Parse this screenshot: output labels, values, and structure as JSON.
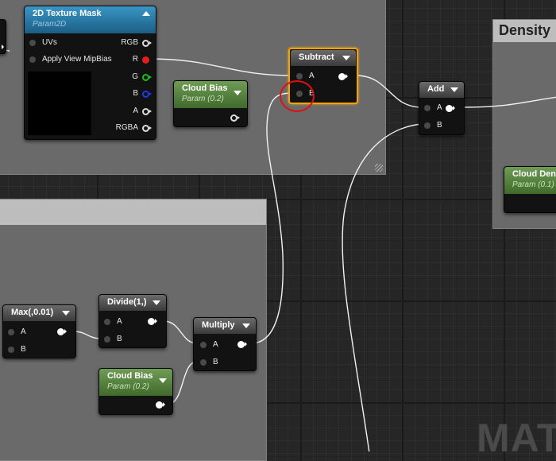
{
  "comments": {
    "top_right_title": "Density",
    "watermark": "MATE"
  },
  "texture_mask": {
    "title": "2D Texture Mask",
    "subtitle": "Param2D",
    "inputs": [
      "UVs",
      "Apply View MipBias"
    ],
    "outputs": [
      "RGB",
      "R",
      "G",
      "B",
      "A",
      "RGBA"
    ],
    "output_colors": {
      "RGB": "#dddddd",
      "R": "#e81c1c",
      "G": "#19c019",
      "B": "#2238e8",
      "A": "#dddddd",
      "RGBA": "#dddddd"
    }
  },
  "cloud_bias_top": {
    "title": "Cloud Bias",
    "subtitle": "Param (0.2)"
  },
  "subtract": {
    "title": "Subtract",
    "pin_a": "A",
    "pin_b": "B"
  },
  "add": {
    "title": "Add",
    "pin_a": "A",
    "pin_b": "B"
  },
  "cloud_density": {
    "title": "Cloud Dens",
    "subtitle": "Param (0.1)"
  },
  "max_node": {
    "title": "Max(,0.01)",
    "pin_a": "A",
    "pin_b": "B"
  },
  "divide": {
    "title": "Divide(1,)",
    "pin_a": "A",
    "pin_b": "B"
  },
  "multiply": {
    "title": "Multiply",
    "pin_a": "A",
    "pin_b": "B"
  },
  "cloud_bias_bottom": {
    "title": "Cloud Bias",
    "subtitle": "Param (0.2)"
  },
  "highlight": {
    "color": "#e01010"
  },
  "accent": {
    "selected_border": "#f0a30a"
  }
}
